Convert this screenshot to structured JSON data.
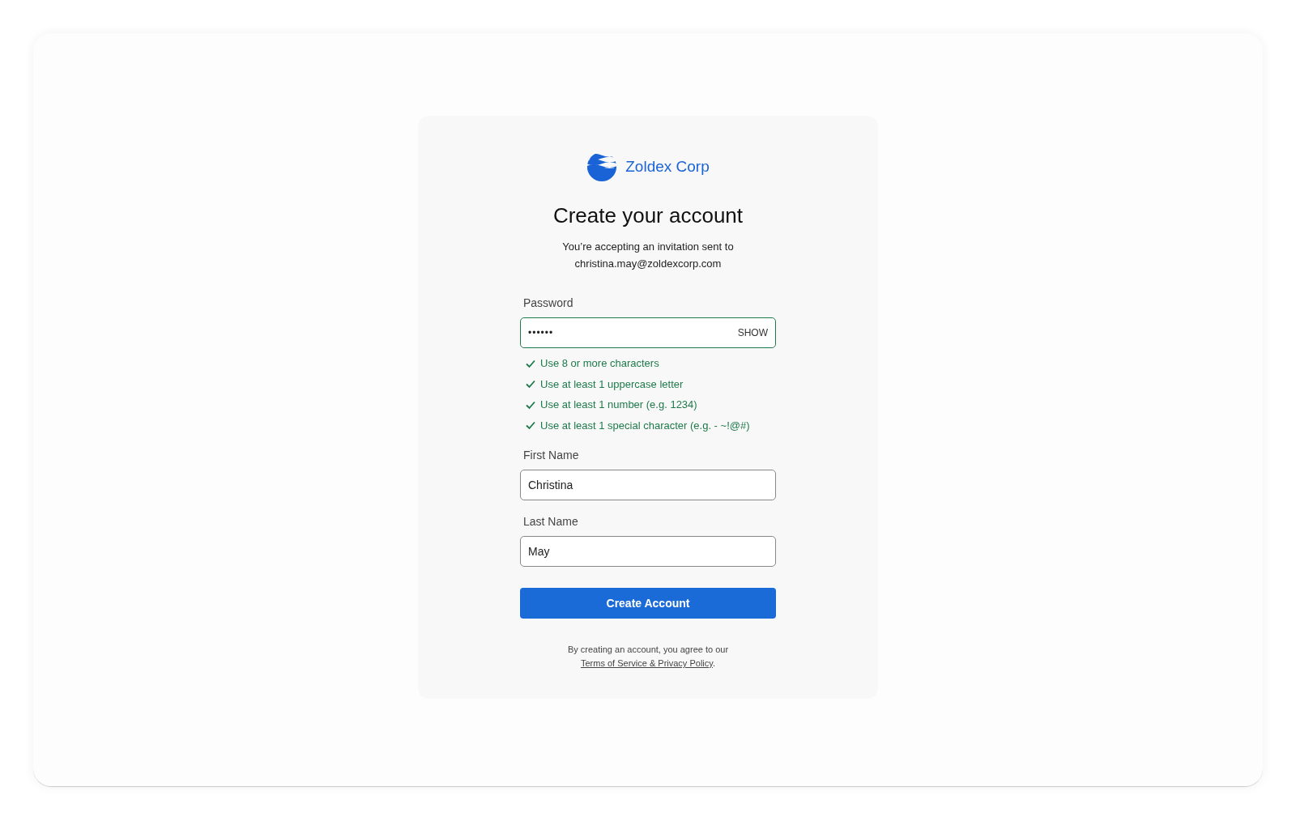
{
  "brand": {
    "name": "Zoldex Corp"
  },
  "title": "Create your account",
  "subtitle": "You’re accepting an invitation sent to",
  "email": "christina.may@zoldexcorp.com",
  "password": {
    "label": "Password",
    "value": "••••••",
    "toggle": "SHOW",
    "valid": true
  },
  "requirements": [
    {
      "text": "Use 8 or more characters",
      "met": true
    },
    {
      "text": "Use at least 1 uppercase letter",
      "met": true
    },
    {
      "text": "Use at least 1 number (e.g. 1234)",
      "met": true
    },
    {
      "text": "Use at least 1 special character (e.g. - ~!@#)",
      "met": true
    }
  ],
  "fields": [
    {
      "label": "First Name",
      "value": "Christina"
    },
    {
      "label": "Last Name",
      "value": "May"
    }
  ],
  "submit": "Create Account",
  "legal": {
    "text": "By creating an account, you agree to our",
    "link": "Terms of Service & Privacy Policy",
    "end": "."
  }
}
